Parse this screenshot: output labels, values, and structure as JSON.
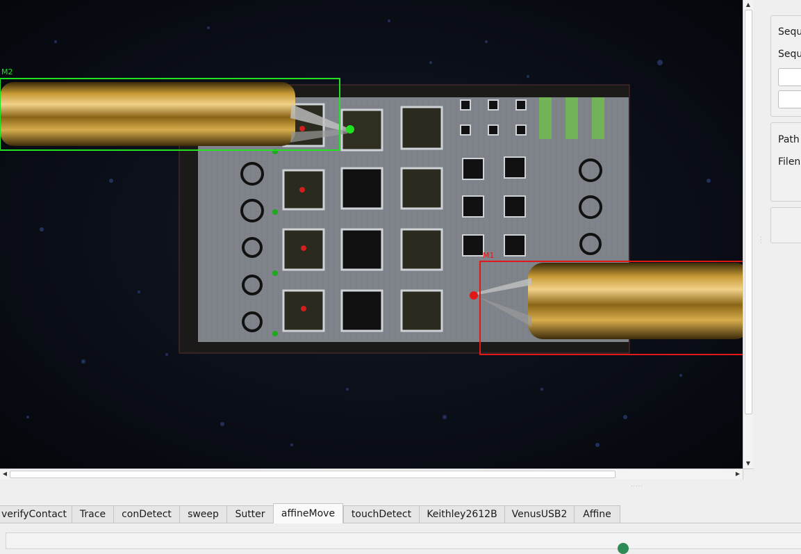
{
  "viewer": {
    "roi_left_label": "M2",
    "roi_right_label": "M1",
    "roi_left_color": "#22e022",
    "roi_right_color": "#e01818"
  },
  "right_panel": {
    "sequence_label_1": "Sequ",
    "sequence_label_2": "Sequ",
    "path_label": "Path",
    "filename_label": "Filen"
  },
  "tabs": [
    {
      "label": "verifyContact"
    },
    {
      "label": "Trace"
    },
    {
      "label": "conDetect"
    },
    {
      "label": "sweep"
    },
    {
      "label": "Sutter"
    },
    {
      "label": "affineMove",
      "active": true
    },
    {
      "label": "touchDetect"
    },
    {
      "label": "Keithley2612B"
    },
    {
      "label": "VenusUSB2"
    },
    {
      "label": "Affine"
    }
  ],
  "colors": {
    "status_indicator": "#2e8b57",
    "background": "#efefef"
  },
  "icons": {
    "scroll_up": "triangle-up-icon",
    "scroll_down": "triangle-down-icon",
    "scroll_left": "triangle-left-icon",
    "scroll_right": "triangle-right-icon"
  }
}
